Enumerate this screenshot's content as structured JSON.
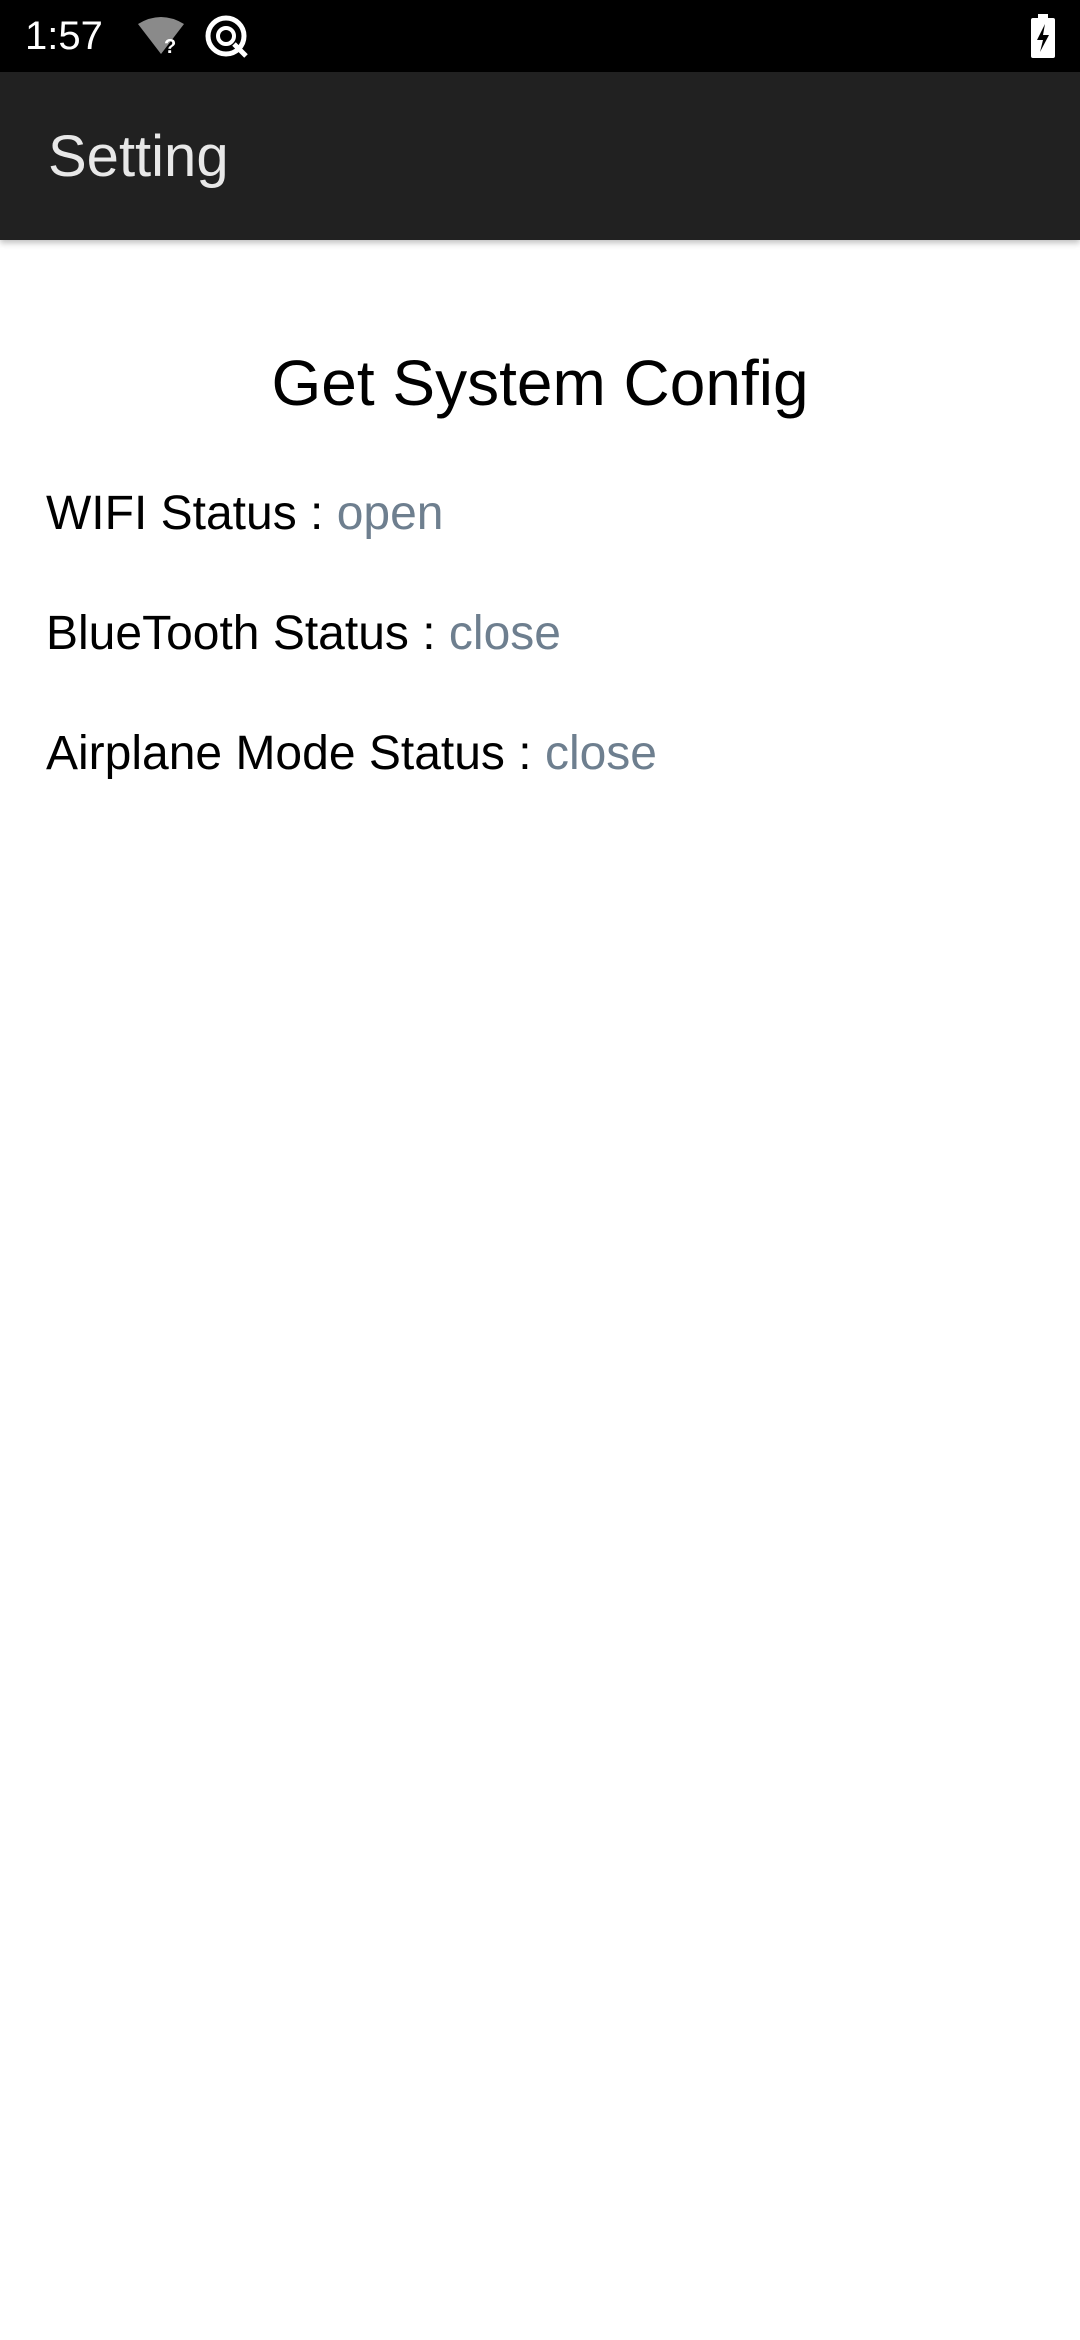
{
  "status_bar": {
    "time": "1:57",
    "icons": [
      "wifi-unknown-icon",
      "sync-icon",
      "battery-charging-icon"
    ]
  },
  "app_bar": {
    "title": "Setting"
  },
  "main": {
    "heading": "Get System Config",
    "rows": [
      {
        "label": "WIFI Status : ",
        "value": "open"
      },
      {
        "label": "BlueTooth Status : ",
        "value": "close"
      },
      {
        "label": "Airplane Mode Status : ",
        "value": "close"
      }
    ]
  },
  "colors": {
    "status_bar_bg": "#000000",
    "app_bar_bg": "#212121",
    "value_text": "#6e7f8f"
  }
}
